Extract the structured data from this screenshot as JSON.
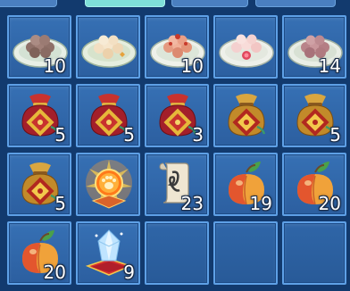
{
  "tabs": [
    {
      "id": "tab-1",
      "active": false
    },
    {
      "id": "tab-2",
      "active": true
    },
    {
      "id": "tab-3",
      "active": false
    },
    {
      "id": "tab-4",
      "active": false
    }
  ],
  "inventory": {
    "slots": [
      {
        "icon": "brown-dumplings-plate-icon",
        "count": "10"
      },
      {
        "icon": "white-dumplings-plate-icon",
        "count": ""
      },
      {
        "icon": "red-dumplings-plate-icon",
        "count": "10"
      },
      {
        "icon": "pink-dumplings-plate-icon",
        "count": ""
      },
      {
        "icon": "mauve-dumplings-plate-icon",
        "count": "14"
      },
      {
        "icon": "red-lucky-bag-icon",
        "count": "5"
      },
      {
        "icon": "red-lucky-bag-icon",
        "count": "5"
      },
      {
        "icon": "red-lucky-bag-icon",
        "count": "3"
      },
      {
        "icon": "gold-lucky-bag-icon",
        "count": ""
      },
      {
        "icon": "gold-lucky-bag-icon",
        "count": "5"
      },
      {
        "icon": "gold-lucky-bag-icon",
        "count": "5"
      },
      {
        "icon": "glowing-paw-orb-icon",
        "count": ""
      },
      {
        "icon": "scroll-icon",
        "count": "23"
      },
      {
        "icon": "peach-icon",
        "count": "19"
      },
      {
        "icon": "peach-icon",
        "count": "20"
      },
      {
        "icon": "peach-icon",
        "count": "20"
      },
      {
        "icon": "crystal-on-cushion-icon",
        "count": "9"
      },
      {
        "icon": "empty-slot",
        "count": ""
      },
      {
        "icon": "empty-slot",
        "count": ""
      },
      {
        "icon": "empty-slot",
        "count": ""
      }
    ]
  },
  "colors": {
    "background": "#123a6e",
    "slot_border": "#5ea0e6",
    "active_tab": "#7fe0d9"
  }
}
